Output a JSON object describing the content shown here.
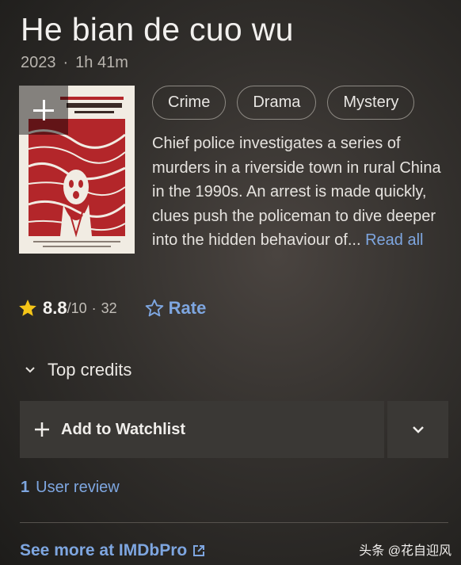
{
  "title": "He bian de cuo wu",
  "meta": {
    "year": "2023",
    "separator": "·",
    "runtime": "1h 41m"
  },
  "genres": [
    "Crime",
    "Drama",
    "Mystery"
  ],
  "plot": {
    "text": "Chief police investigates a series of murders in a riverside town in rural China in the 1990s. An arrest is made quickly, clues push the policeman to dive deeper into the hidden behaviour of...",
    "more_label": "Read all"
  },
  "rating": {
    "score": "8.8",
    "out_of": "/10",
    "separator": "·",
    "votes": "32",
    "rate_label": "Rate",
    "accent": "#f5c518"
  },
  "credits_label": "Top credits",
  "watchlist_label": "Add to Watchlist",
  "reviews": {
    "count": "1",
    "label": "User review"
  },
  "imdbpro_label": "See more at IMDbPro",
  "watermark": "头条 @花自迎风",
  "colors": {
    "link": "#7ea6e0",
    "poster_red": "#b3262a"
  }
}
